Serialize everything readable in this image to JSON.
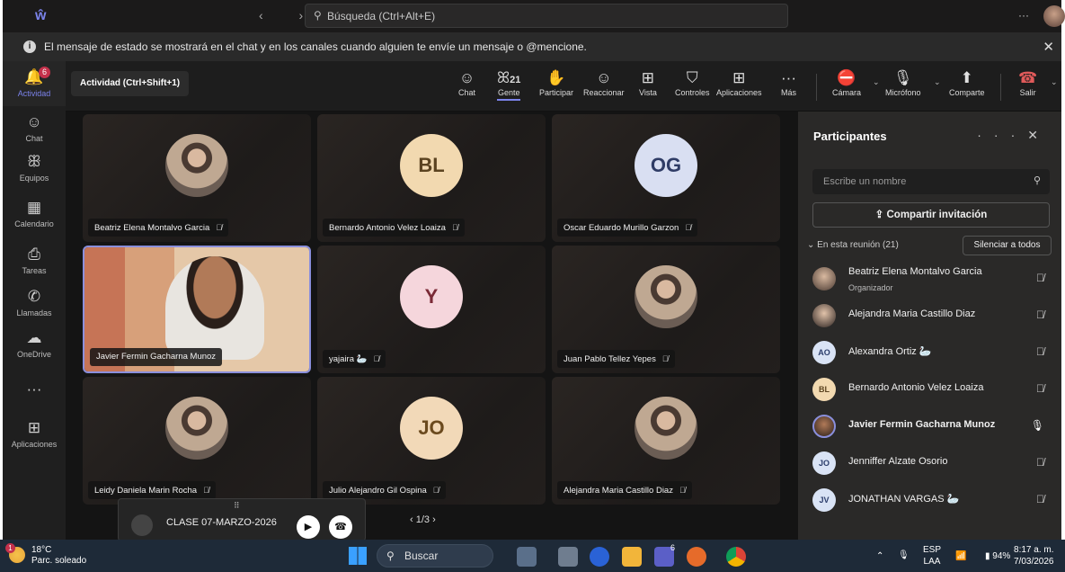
{
  "titlebar": {
    "search_placeholder": "Búsqueda (Ctrl+Alt+E)",
    "more": "···",
    "nav": "‹ ›"
  },
  "infobar": {
    "message": "El mensaje de estado se mostrará en el chat y en los canales cuando alguien te envíe un mensaje o @mencione."
  },
  "rail": [
    {
      "label": "Actividad",
      "icon": "bell-icon",
      "glyph": "🔔",
      "badge": "6"
    },
    {
      "label": "Chat",
      "icon": "chat-icon",
      "glyph": "☺"
    },
    {
      "label": "Equipos",
      "icon": "teams-icon",
      "glyph": "ꕥ"
    },
    {
      "label": "Calendario",
      "icon": "calendar-icon",
      "glyph": "▦"
    },
    {
      "label": "Tareas",
      "icon": "tasks-icon",
      "glyph": "⎙"
    },
    {
      "label": "Llamadas",
      "icon": "phone-icon",
      "glyph": "✆"
    },
    {
      "label": "OneDrive",
      "icon": "cloud-icon",
      "glyph": "☁"
    },
    {
      "label": "",
      "icon": "more-icon",
      "glyph": "···"
    },
    {
      "label": "Aplicaciones",
      "icon": "apps-icon",
      "glyph": "⊞"
    }
  ],
  "meeting": {
    "title": "Actividad (Ctrl+Shift+1)",
    "tools": {
      "chat": "Chat",
      "people": "Gente",
      "people_count": "21",
      "raise": "Participar",
      "react": "Reaccionar",
      "view": "Vista",
      "controls": "Controles",
      "apps": "Aplicaciones",
      "more": "Más",
      "camera": "Cámara",
      "mic": "Micrófono",
      "share": "Comparte",
      "leave": "Salir"
    }
  },
  "tiles": [
    {
      "name": "Beatriz Elena Montalvo Garcia",
      "type": "photo"
    },
    {
      "name": "Bernardo Antonio Velez Loaiza",
      "initials": "BL",
      "color": "#f2d9b0",
      "fg": "#5b4320"
    },
    {
      "name": "Oscar Eduardo Murillo Garzon",
      "initials": "OG",
      "color": "#d9dff2",
      "fg": "#2f3c66"
    },
    {
      "name": "Javier Fermin Gacharna Munoz",
      "type": "video"
    },
    {
      "name": "yajaira",
      "initials": "Y",
      "color": "#f5d6dc",
      "fg": "#7a2a36",
      "extra": "🦢"
    },
    {
      "name": "Juan Pablo Tellez Yepes",
      "type": "photo"
    },
    {
      "name": "Leidy Daniela Marin Rocha",
      "type": "photo"
    },
    {
      "name": "Julio Alejandro Gil Ospina",
      "initials": "JO",
      "color": "#f2d9b8",
      "fg": "#6b4a1e"
    },
    {
      "name": "Alejandra Maria Castillo Diaz",
      "type": "photo"
    }
  ],
  "pager": "‹  1/3  ›",
  "pip": {
    "title": "CLASE 07-MARZO-2026",
    "drag": "⠿"
  },
  "panel": {
    "title": "Participantes",
    "search_placeholder": "Escribe un nombre",
    "invite": "Compartir invitación",
    "section": "En esta reunión (21)",
    "mute_all": "Silenciar a todos",
    "people": [
      {
        "name": "Beatriz Elena Montalvo Garcia",
        "sub": "Organizador",
        "avatar": "photo",
        "mic": "muted"
      },
      {
        "name": "Alejandra Maria Castillo Diaz",
        "avatar": "photo",
        "mic": "muted"
      },
      {
        "name": "Alexandra Ortiz 🦢",
        "initials": "AO",
        "color": "#d9e3f5",
        "fg": "#2b3d6b",
        "mic": "muted"
      },
      {
        "name": "Bernardo Antonio Velez Loaiza",
        "initials": "BL",
        "color": "#f2d9b0",
        "fg": "#5b4320",
        "mic": "muted"
      },
      {
        "name": "Javier Fermin Gacharna Munoz",
        "avatar": "photo",
        "mic": "on",
        "bold": true
      },
      {
        "name": "Jenniffer Alzate Osorio",
        "initials": "JO",
        "color": "#d9e3f5",
        "fg": "#2b3d6b",
        "mic": "muted"
      },
      {
        "name": "JONATHAN VARGAS 🦢",
        "initials": "JV",
        "color": "#d9e3f5",
        "fg": "#2b3d6b",
        "mic": "muted"
      }
    ]
  },
  "taskbar": {
    "temp": "18°C",
    "weather": "Parc. soleado",
    "weather_badge": "1",
    "search": "Buscar",
    "lang": "ESP",
    "lang2": "LAA",
    "battery": "94%",
    "time": "8:17 a. m.",
    "date": "7/03/2026",
    "teams_badge": "6"
  }
}
